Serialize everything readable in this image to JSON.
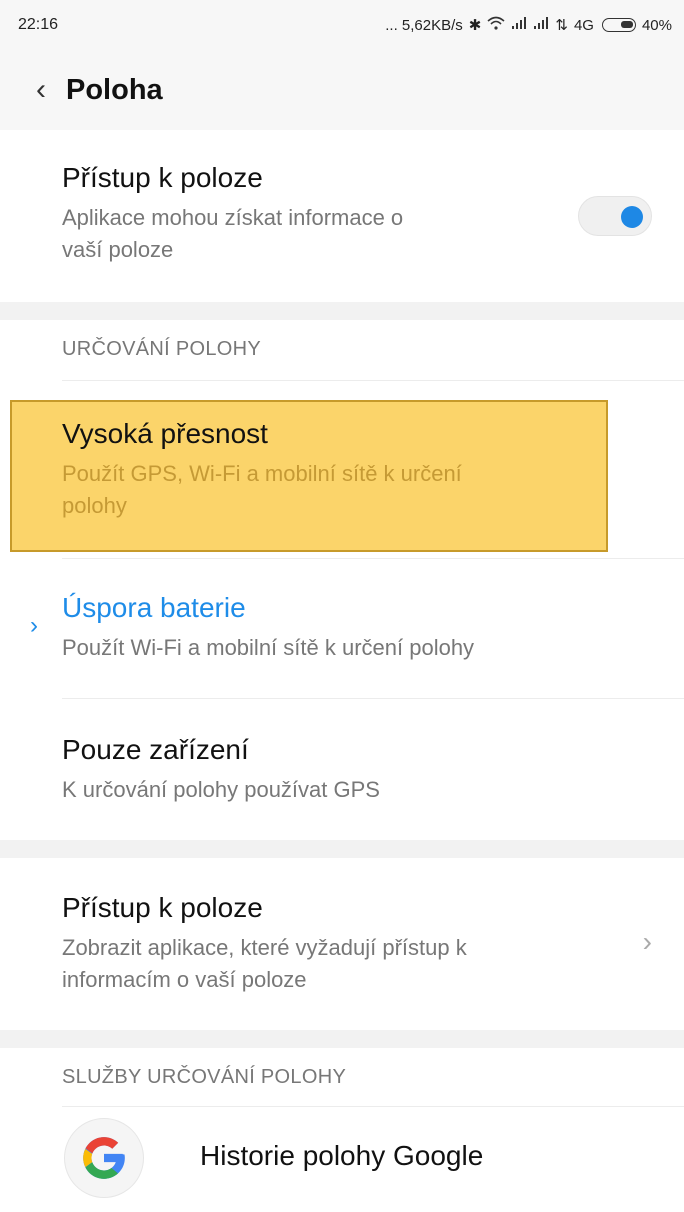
{
  "status_bar": {
    "time": "22:16",
    "speed": "... 5,62KB/s",
    "network": "4G",
    "battery": "40%"
  },
  "app_bar": {
    "title": "Poloha"
  },
  "location_access": {
    "title": "Přístup k poloze",
    "subtitle_line1": "Aplikace mohou získat informace o",
    "subtitle_line2": "vaší poloze",
    "enabled": true
  },
  "mode_section": {
    "header": "URČOVÁNÍ POLOHY",
    "options": [
      {
        "title": "Vysoká přesnost",
        "subtitle_line1": "Použít GPS, Wi-Fi a mobilní sítě k určení",
        "subtitle_line2": "polohy"
      },
      {
        "title": "Úspora baterie",
        "subtitle_line1": "Použít Wi-Fi a mobilní sítě k určení polohy",
        "selected": true
      },
      {
        "title": "Pouze zařízení",
        "subtitle_line1": "K určování polohy používat GPS"
      }
    ]
  },
  "app_access": {
    "title": "Přístup k poloze",
    "subtitle_line1": "Zobrazit aplikace, které vyžadují přístup k",
    "subtitle_line2": "informacím o vaší poloze"
  },
  "services_section": {
    "header": "SLUŽBY URČOVÁNÍ POLOHY",
    "items": [
      {
        "label": "Historie polohy Google",
        "icon": "google-icon"
      }
    ]
  },
  "colors": {
    "accent": "#1e8ce8",
    "highlight": "#facd50"
  }
}
